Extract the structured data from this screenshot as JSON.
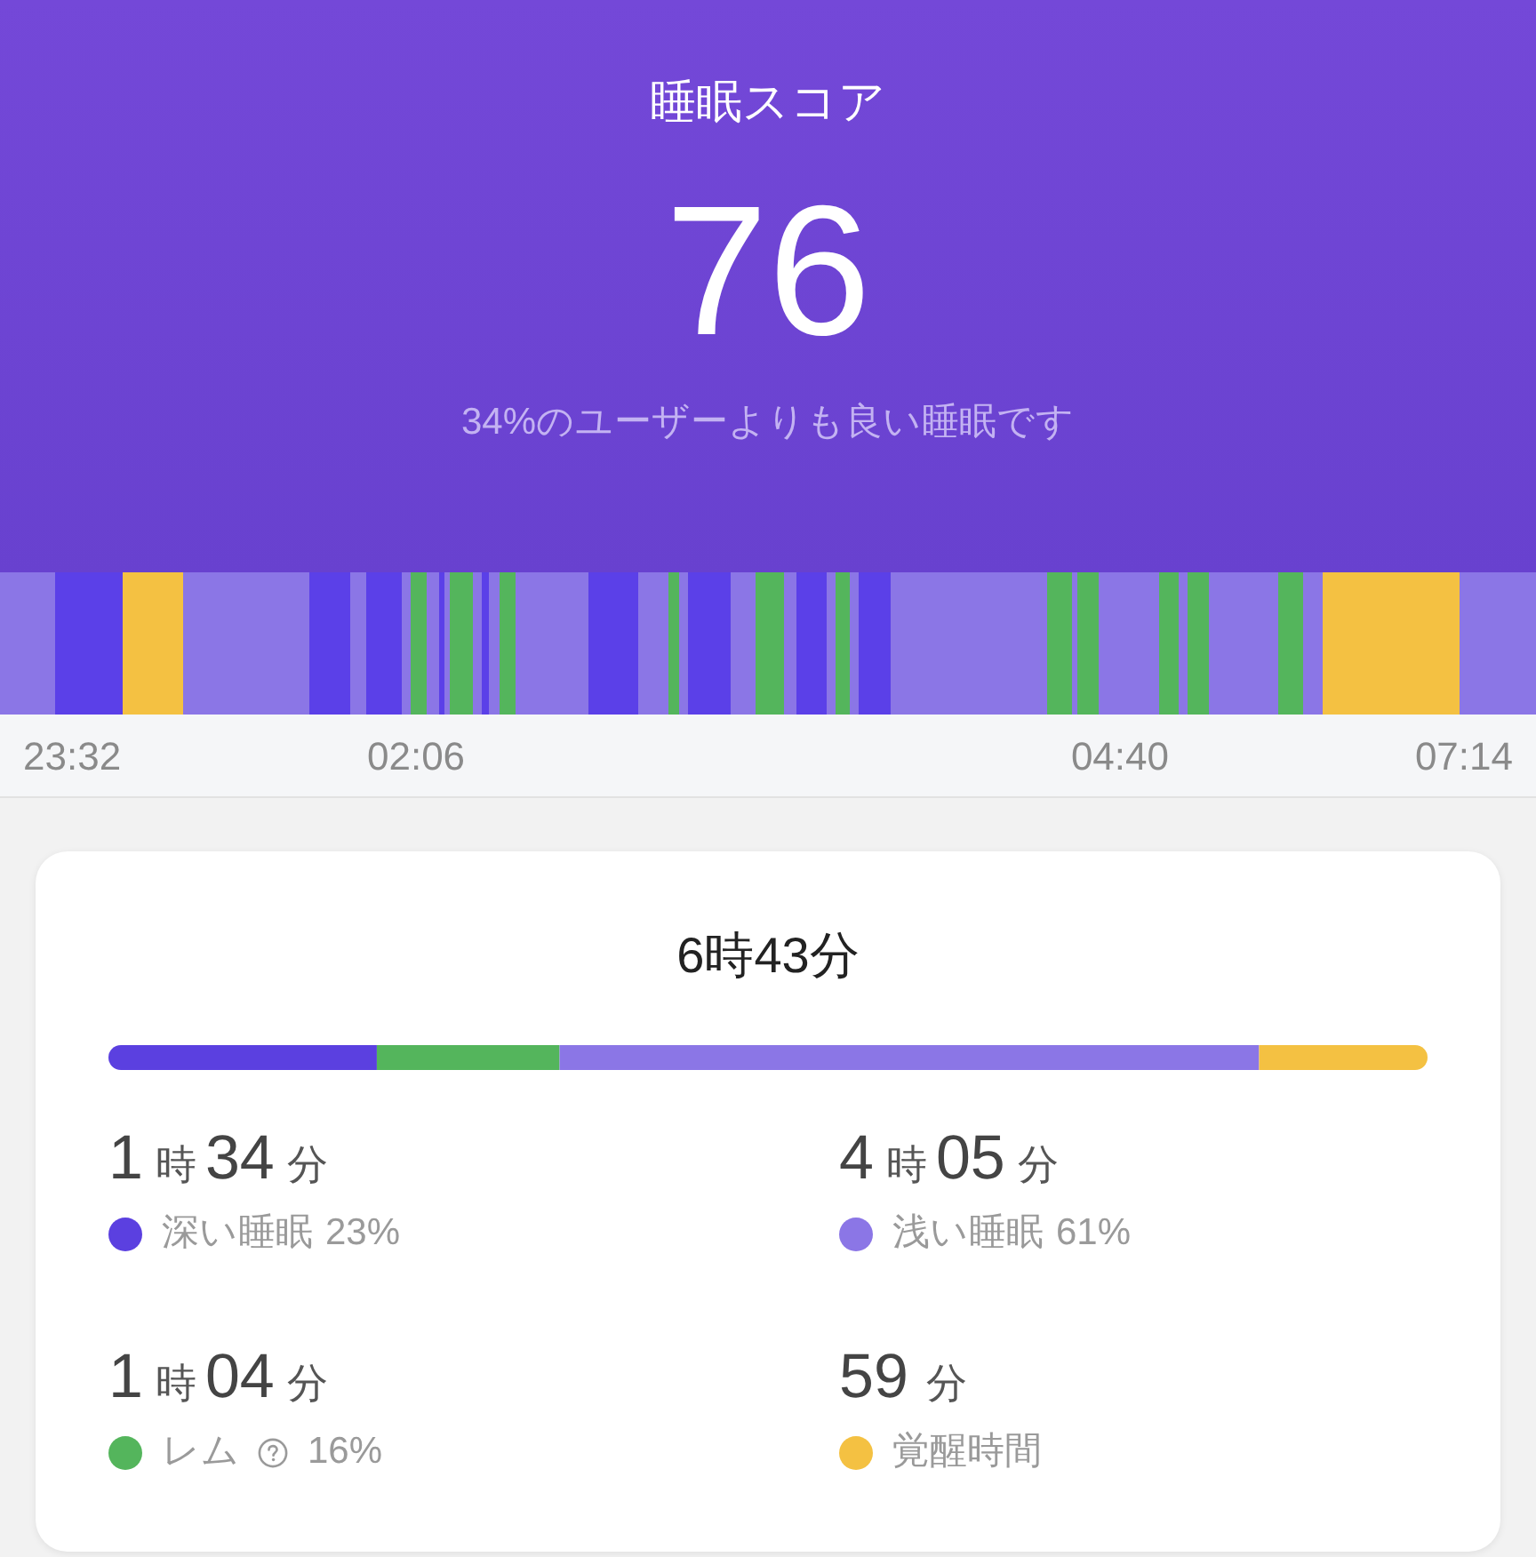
{
  "header": {
    "title": "睡眠スコア",
    "score": "76",
    "comparison": "34%のユーザーよりも良い睡眠です"
  },
  "hypnogram": {
    "time_labels": [
      "23:32",
      "02:06",
      "04:40",
      "07:14"
    ]
  },
  "summary": {
    "total": "6時43分",
    "stages": [
      {
        "kind": "deep",
        "hours": "1",
        "hour_unit": "時",
        "minutes": "34",
        "minute_unit": "分",
        "label": "深い睡眠",
        "info": false,
        "percent": "23%",
        "color": "#5b40e0"
      },
      {
        "kind": "light",
        "hours": "4",
        "hour_unit": "時",
        "minutes": "05",
        "minute_unit": "分",
        "label": "浅い睡眠",
        "info": false,
        "percent": "61%",
        "color": "#8b76e6"
      },
      {
        "kind": "rem",
        "hours": "1",
        "hour_unit": "時",
        "minutes": "04",
        "minute_unit": "分",
        "label": "レム",
        "info": true,
        "percent": "16%",
        "color": "#54b55c"
      },
      {
        "kind": "awake",
        "minutes": "59",
        "minute_unit": "分",
        "label": "覚醒時間",
        "info": false,
        "color": "#f4c142"
      }
    ]
  }
}
